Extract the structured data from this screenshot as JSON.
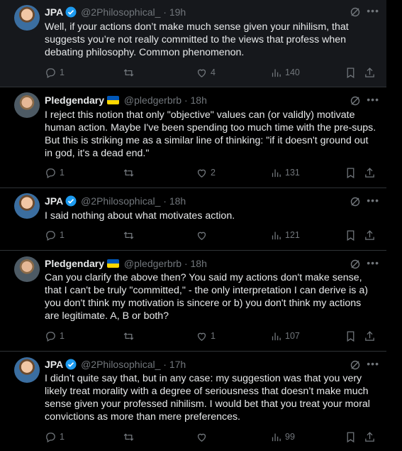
{
  "tweets": [
    {
      "name": "JPA",
      "handle": "@2Philosophical_",
      "time": "· 19h",
      "verified": true,
      "flag": false,
      "text": "Well, if your actions don’t make much sense given your nihilism, that suggests you’re not really committed to the views that profess when debating philosophy. Common phenomenon.",
      "reply": "1",
      "retweet": "",
      "like": "4",
      "views": "140"
    },
    {
      "name": "Pledgendary",
      "handle": "@pledgerbrb",
      "time": "· 18h",
      "verified": false,
      "flag": true,
      "text": "I reject this notion that only \"objective\" values can (or validly) motivate human action. Maybe I've been spending too much time with the pre-sups. But this is striking me as a similar line of thinking: \"if it doesn't ground out in god, it's a dead end.\"",
      "reply": "1",
      "retweet": "",
      "like": "2",
      "views": "131"
    },
    {
      "name": "JPA",
      "handle": "@2Philosophical_",
      "time": "· 18h",
      "verified": true,
      "flag": false,
      "text": "I said nothing about what motivates action.",
      "reply": "1",
      "retweet": "",
      "like": "",
      "views": "121"
    },
    {
      "name": "Pledgendary",
      "handle": "@pledgerbrb",
      "time": "· 18h",
      "verified": false,
      "flag": true,
      "text": "Can you clarify the above then? You said my actions don't make sense, that I can't be truly \"committed,\" - the only interpretation I can derive is a) you don't think my motivation is sincere or b) you don't think my actions are legitimate. A, B or both?",
      "reply": "1",
      "retweet": "",
      "like": "1",
      "views": "107"
    },
    {
      "name": "JPA",
      "handle": "@2Philosophical_",
      "time": "· 17h",
      "verified": true,
      "flag": false,
      "text": "I didn’t quite say that, but in any case: my suggestion was that you very likely treat morality with a degree of seriousness that doesn’t make much sense given your professed nihilism. I would bet that you treat your moral convictions as more than mere preferences.",
      "reply": "1",
      "retweet": "",
      "like": "",
      "views": "99"
    }
  ],
  "colors": {
    "accent": "#1d9bf0",
    "muted": "#71767b",
    "text": "#e7e9ea",
    "divider": "#2f3336",
    "bg": "#000000"
  },
  "icons": {
    "reply": "reply-icon",
    "retweet": "retweet-icon",
    "like": "like-icon",
    "views": "views-icon",
    "bookmark": "bookmark-icon",
    "share": "share-icon",
    "grok": "grok-icon",
    "more": "more-icon"
  }
}
